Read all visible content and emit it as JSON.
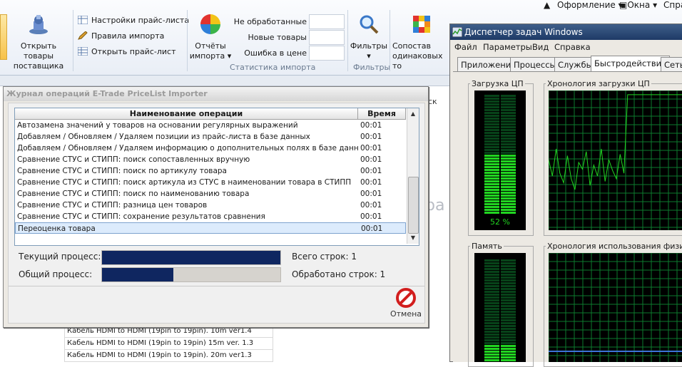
{
  "topmenu": {
    "design": "Оформление",
    "windows": "Окна",
    "help": "Спра"
  },
  "ribbon": {
    "open_supplier_goods": "Открыть товары поставщика",
    "pricelist_settings": "Настройки прайс-листа",
    "import_rules": "Правила импорта",
    "open_pricelist": "Открыть прайс-лист",
    "import_reports": "Отчёты импорта",
    "stat_unprocessed": "Не обработанные",
    "stat_new_goods": "Новые товары",
    "stat_price_error": "Ошибка в цене",
    "import_stats_group": "Статистика импорта",
    "filters": "Фильтры",
    "filters_group": "Фильтры",
    "match_same": "Сопостав одинаковых то"
  },
  "background": {
    "stray_fragment_1": "ск",
    "stray_fragment_2": "ра",
    "rows": [
      "Кабель HDMI to HDMI (19pin to 19pin). 10m ver1.4",
      "Кабель HDMI to HDMI (19pin to 19pin) 15m ver. 1.3",
      "Кабель HDMI to HDMI (19pin to 19pin). 20m ver1.3"
    ]
  },
  "journal": {
    "title": "Журнал операций E-Trade PriceList Importer",
    "col_name": "Наименование операции",
    "col_time": "Время",
    "rows": [
      {
        "name": "Автозамена значений у товаров на основании регулярных выражений",
        "time": "00:01"
      },
      {
        "name": "Добавляем / Обновляем / Удаляем позиции из прайс-листа в базе данных",
        "time": "00:01"
      },
      {
        "name": "Добавляем / Обновляем / Удаляем информацию о дополнительных полях в базе данных",
        "time": "00:01"
      },
      {
        "name": "Сравнение СТУС и СТИПП: поиск сопоставленных вручную",
        "time": "00:01"
      },
      {
        "name": "Сравнение СТУС и СТИПП: поиск по артикулу товара",
        "time": "00:01"
      },
      {
        "name": "Сравнение СТУС и СТИПП: поиск артикула из СТУС в наименовании товара в СТИПП",
        "time": "00:01"
      },
      {
        "name": "Сравнение СТУС и СТИПП: поиск по наименованию товара",
        "time": "00:01"
      },
      {
        "name": "Сравнение СТУС и СТИПП: разница цен товаров",
        "time": "00:01"
      },
      {
        "name": "Сравнение СТУС и СТИПП: сохранение результатов сравнения",
        "time": "00:01"
      },
      {
        "name": "Переоценка товара",
        "time": "00:01"
      }
    ],
    "current_process_label": "Текущий процесс:",
    "overall_process_label": "Общий процесс:",
    "current_progress": 1.0,
    "overall_progress": 0.4,
    "total_rows": "Всего строк: 1",
    "processed_rows": "Обработано строк: 1",
    "cancel": "Отмена"
  },
  "taskmanager": {
    "title": "Диспетчер задач Windows",
    "menu": [
      "Файл",
      "Параметры",
      "Вид",
      "Справка"
    ],
    "tabs": [
      "Приложения",
      "Процессы",
      "Службы",
      "Быстродействие",
      "Сеть"
    ],
    "active_tab": "Быстродействие",
    "cpu_load_label": "Загрузка ЦП",
    "cpu_history_label": "Хронология загрузки ЦП",
    "cpu_percent": "52 %",
    "cpu_level": 0.52,
    "memory_label": "Память",
    "memory_history_label": "Хронология использования физическ"
  },
  "colors": {
    "progress_fill": "#0f2660",
    "graph_green": "#21d521",
    "grid_green": "#0d7a2e"
  }
}
